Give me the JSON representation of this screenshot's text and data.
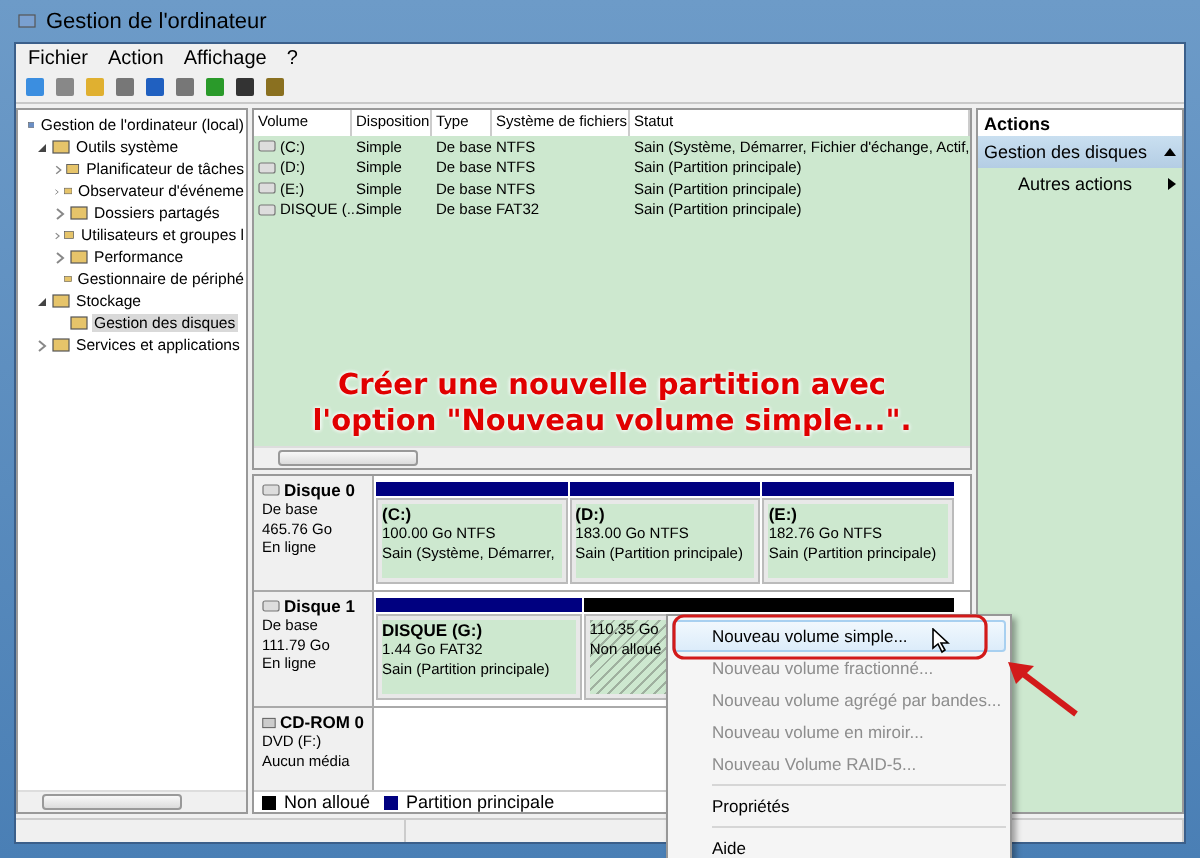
{
  "window": {
    "title": "Gestion de l'ordinateur"
  },
  "menu": [
    "Fichier",
    "Action",
    "Affichage",
    "?"
  ],
  "tree": [
    {
      "label": "Gestion de l'ordinateur (local)",
      "selected": false,
      "children": [
        {
          "label": "Outils système",
          "selected": false,
          "expanded": true,
          "children": [
            {
              "label": "Planificateur de tâches",
              "selected": false,
              "expanded": false
            },
            {
              "label": "Observateur d'événeme",
              "selected": false,
              "expanded": false
            },
            {
              "label": "Dossiers partagés",
              "selected": false,
              "expanded": false
            },
            {
              "label": "Utilisateurs et groupes l",
              "selected": false,
              "expanded": false
            },
            {
              "label": "Performance",
              "selected": false,
              "expanded": false
            },
            {
              "label": "Gestionnaire de périphé",
              "selected": false
            }
          ]
        },
        {
          "label": "Stockage",
          "selected": false,
          "expanded": true,
          "children": [
            {
              "label": "Gestion des disques",
              "selected": true
            }
          ]
        },
        {
          "label": "Services et applications",
          "selected": false,
          "expanded": false
        }
      ]
    }
  ],
  "volumes": {
    "columns": [
      "Volume",
      "Disposition",
      "Type",
      "Système de fichiers",
      "Statut"
    ],
    "rows": [
      [
        "(C:)",
        "Simple",
        "De base",
        "NTFS",
        "Sain (Système, Démarrer, Fichier d'échange, Actif,"
      ],
      [
        "(D:)",
        "Simple",
        "De base",
        "NTFS",
        "Sain (Partition principale)"
      ],
      [
        "(E:)",
        "Simple",
        "De base",
        "NTFS",
        "Sain (Partition principale)"
      ],
      [
        "DISQUE (...",
        "Simple",
        "De base",
        "FAT32",
        "Sain (Partition principale)"
      ]
    ]
  },
  "annotation": [
    "Créer une nouvelle partition avec",
    "l'option \"Nouveau volume simple...\"."
  ],
  "disks": [
    {
      "kind": "disk",
      "name": "Disque 0",
      "lines": [
        "De base",
        "465.76 Go",
        "En ligne"
      ],
      "partitions": [
        {
          "kind": "primary",
          "label": "(C:)",
          "lines": [
            "100.00 Go NTFS",
            "Sain (Système, Démarrer,"
          ]
        },
        {
          "kind": "primary",
          "label": "(D:)",
          "lines": [
            "183.00 Go NTFS",
            "Sain (Partition principale)"
          ]
        },
        {
          "kind": "primary",
          "label": "(E:)",
          "lines": [
            "182.76 Go NTFS",
            "Sain (Partition principale)"
          ]
        }
      ]
    },
    {
      "kind": "disk",
      "name": "Disque 1",
      "lines": [
        "De base",
        "111.79 Go",
        "En ligne"
      ],
      "partitions": [
        {
          "kind": "primary",
          "label": "DISQUE  (G:)",
          "lines": [
            "1.44 Go FAT32",
            "Sain (Partition principale)"
          ]
        },
        {
          "kind": "unallocated",
          "lines": [
            "110.35 Go",
            "Non alloué"
          ]
        }
      ]
    },
    {
      "kind": "cdrom",
      "name": "CD-ROM 0",
      "lines": [
        "DVD (F:)",
        "Aucun média"
      ]
    }
  ],
  "legend": [
    {
      "label": "Non alloué",
      "color": "#000000"
    },
    {
      "label": "Partition principale",
      "color": "#000080"
    }
  ],
  "actions": {
    "title": "Actions",
    "items": [
      {
        "kind": "header",
        "label": "Gestion des disques"
      },
      {
        "kind": "submenu",
        "label": "Autres actions"
      }
    ]
  },
  "context_menu": [
    [
      {
        "label": "Nouveau volume simple...",
        "disabled": false,
        "selected": true
      },
      {
        "label": "Nouveau volume fractionné...",
        "disabled": true,
        "selected": false
      },
      {
        "label": "Nouveau volume agrégé par bandes...",
        "disabled": true,
        "selected": false
      },
      {
        "label": "Nouveau volume en miroir...",
        "disabled": true,
        "selected": false
      },
      {
        "label": "Nouveau Volume RAID-5...",
        "disabled": true,
        "selected": false
      }
    ],
    [
      {
        "label": "Propriétés",
        "disabled": false,
        "selected": false
      }
    ],
    [
      {
        "label": "Aide",
        "disabled": false,
        "selected": false
      }
    ]
  ]
}
